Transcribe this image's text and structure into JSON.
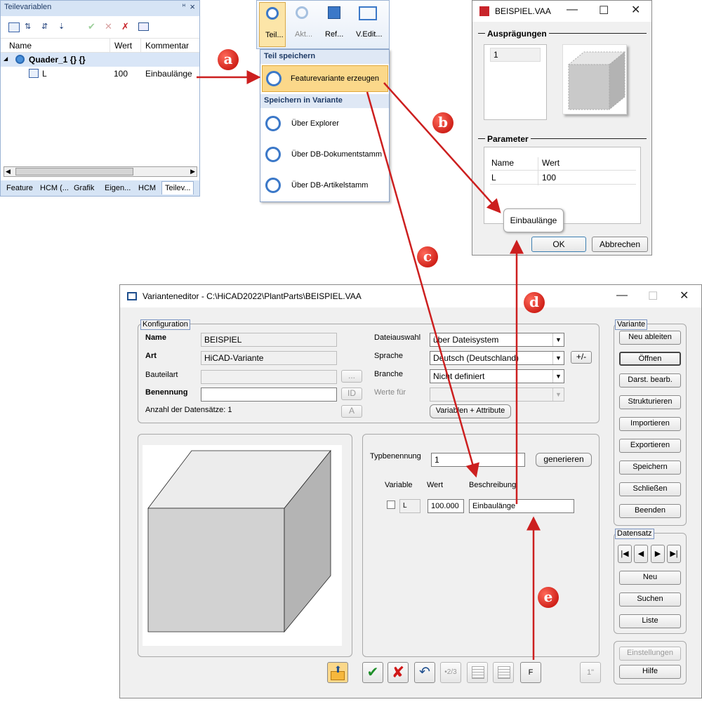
{
  "teilevariablen": {
    "title": "Teilevariablen",
    "pin": "ᵸ",
    "close": "×",
    "columns": [
      "Name",
      "Wert",
      "Kommentar"
    ],
    "root_node": "Quader_1 {} {}",
    "row": {
      "name": "L",
      "wert": "100",
      "kommentar": "Einbaulänge"
    },
    "tabs": [
      "Feature",
      "HCM (...",
      "Grafik",
      "Eigen...",
      "HCM",
      "Teilev..."
    ]
  },
  "ribbon": {
    "buttons": [
      "Teil...",
      "Akt...",
      "Ref...",
      "V.Edit..."
    ],
    "section1": "Teil speichern",
    "item1": "Featurevariante erzeugen",
    "section2": "Speichern in Variante",
    "item2": "Über Explorer",
    "item3": "Über DB-Dokumentstamm",
    "item4": "Über DB-Artikelstamm"
  },
  "beispiel": {
    "title": "BEISPIEL.VAA",
    "group1": "Ausprägungen",
    "list_value": "1",
    "group2": "Parameter",
    "col_name": "Name",
    "col_wert": "Wert",
    "param_name": "L",
    "param_value": "100",
    "tooltip": "Einbaulänge",
    "ok": "OK",
    "cancel": "Abbrechen"
  },
  "editor": {
    "title": "Varianteneditor - C:\\HiCAD2022\\PlantParts\\BEISPIEL.VAA",
    "konfig": "Konfiguration",
    "name_label": "Name",
    "name_value": "BEISPIEL",
    "art_label": "Art",
    "art_value": "HiCAD-Variante",
    "bauteilart_label": "Bauteilart",
    "benennung_label": "Benennung",
    "anzahl": "Anzahl der Datensätze: 1",
    "dots": "...",
    "id": "ID",
    "a": "A",
    "dateiauswahl_label": "Dateiauswahl",
    "dateiauswahl_value": "über Dateisystem",
    "sprache_label": "Sprache",
    "sprache_value": "Deutsch (Deutschland)",
    "branche_label": "Branche",
    "branche_value": "Nicht definiert",
    "werte_fuer_label": "Werte für",
    "plusminus": "+/-",
    "var_attr": "Variablen + Attribute",
    "typbenennung_label": "Typbenennung",
    "typbenennung_value": "1",
    "generieren": "generieren",
    "col_variable": "Variable",
    "col_wert": "Wert",
    "col_beschreibung": "Beschreibung",
    "var_name": "L",
    "var_wert": "100.000",
    "var_beschreibung": "Einbaulänge",
    "variante_group": "Variante",
    "variante_buttons": [
      "Neu ableiten",
      "Öffnen",
      "Darst. bearb.",
      "Strukturieren",
      "Importieren",
      "Exportieren",
      "Speichern",
      "Schließen",
      "Beenden"
    ],
    "datensatz_group": "Datensatz",
    "datensatz_buttons": [
      "Neu",
      "Suchen",
      "Liste"
    ],
    "einstellungen": "Einstellungen",
    "hilfe": "Hilfe",
    "bottom_count": "•2/3",
    "bottom_f": "F",
    "bottom_1": "1\""
  },
  "markers": [
    "a",
    "b",
    "c",
    "d",
    "e"
  ],
  "colors": {
    "arrow": "#cc1f1f",
    "highlight": "#fbd88a",
    "tab_active": "#ffffff",
    "marker": "#d0221a"
  }
}
